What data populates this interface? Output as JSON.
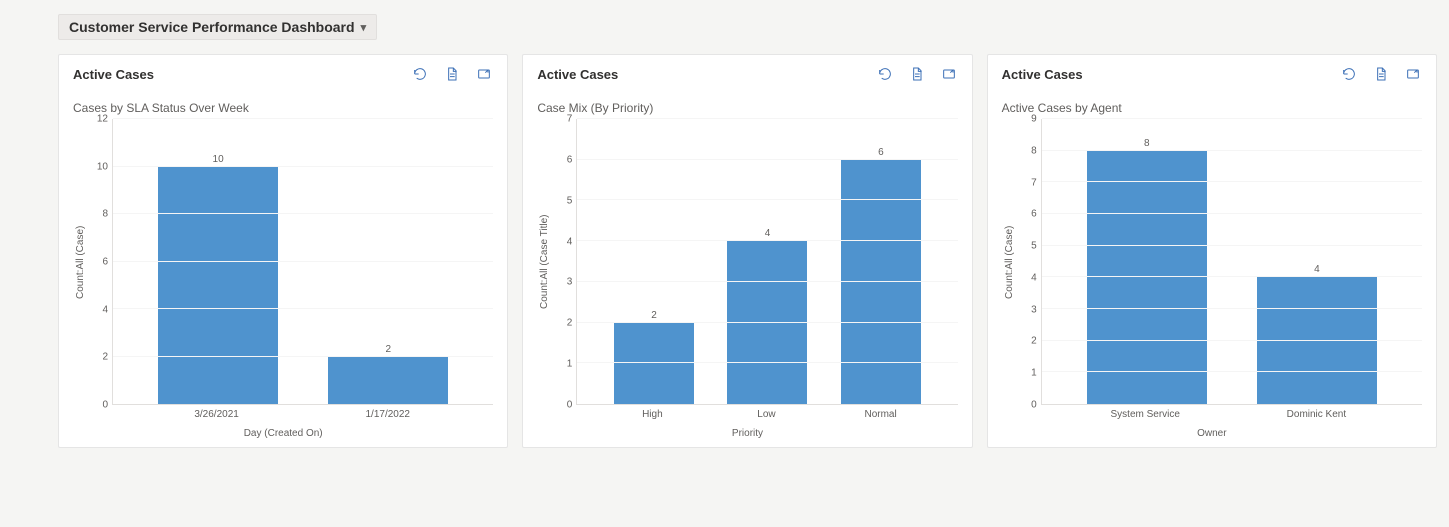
{
  "dashboard": {
    "title": "Customer Service Performance Dashboard"
  },
  "card_actions": {
    "refresh": "Refresh",
    "records": "View records",
    "expand": "Expand"
  },
  "cards": [
    {
      "title": "Active Cases",
      "subtitle": "Cases by SLA Status Over Week"
    },
    {
      "title": "Active Cases",
      "subtitle": "Case Mix (By Priority)"
    },
    {
      "title": "Active Cases",
      "subtitle": "Active Cases by Agent"
    }
  ],
  "chart_data": [
    {
      "type": "bar",
      "title": "Cases by SLA Status Over Week",
      "xlabel": "Day (Created On)",
      "ylabel": "Count:All (Case)",
      "ylim": [
        0,
        12
      ],
      "yticks": [
        0,
        2,
        4,
        6,
        8,
        10,
        12
      ],
      "categories": [
        "3/26/2021",
        "1/17/2022"
      ],
      "values": [
        10,
        2
      ],
      "bar_color": "#4f93ce"
    },
    {
      "type": "bar",
      "title": "Case Mix (By Priority)",
      "xlabel": "Priority",
      "ylabel": "Count:All (Case Title)",
      "ylim": [
        0,
        7
      ],
      "yticks": [
        0,
        1,
        2,
        3,
        4,
        5,
        6,
        7
      ],
      "categories": [
        "High",
        "Low",
        "Normal"
      ],
      "values": [
        2,
        4,
        6
      ],
      "bar_color": "#4f93ce"
    },
    {
      "type": "bar",
      "title": "Active Cases by Agent",
      "xlabel": "Owner",
      "ylabel": "Count:All (Case)",
      "ylim": [
        0,
        9
      ],
      "yticks": [
        0,
        1,
        2,
        3,
        4,
        5,
        6,
        7,
        8,
        9
      ],
      "categories": [
        "System Service",
        "Dominic Kent"
      ],
      "values": [
        8,
        4
      ],
      "bar_color": "#4f93ce"
    }
  ]
}
